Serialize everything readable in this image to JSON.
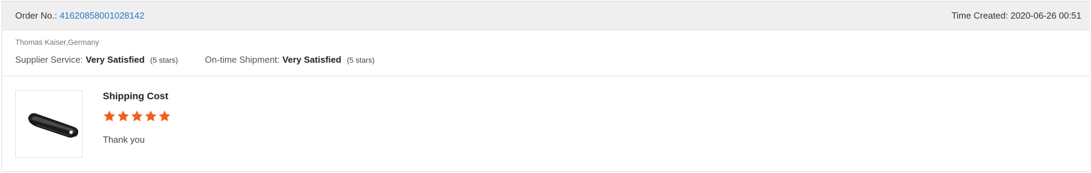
{
  "header": {
    "order_label": "Order No.:",
    "order_number": "41620858001028142",
    "time_label": "Time Created:",
    "time_value": "2020-06-26 00:51"
  },
  "buyer": "Thomas Kaiser,Germany",
  "ratings": [
    {
      "label": "Supplier Service:",
      "value": "Very Satisfied",
      "note": "(5 stars)"
    },
    {
      "label": "On-time Shipment:",
      "value": "Very Satisfied",
      "note": "(5 stars)"
    }
  ],
  "product": {
    "title": "Shipping Cost",
    "rating": 5,
    "rating_max": 5,
    "review": "Thank you",
    "image_icon": "black-metal-clip-image"
  },
  "colors": {
    "link": "#2b78c5",
    "star": "#f0601b",
    "header_bg": "#efefef"
  }
}
